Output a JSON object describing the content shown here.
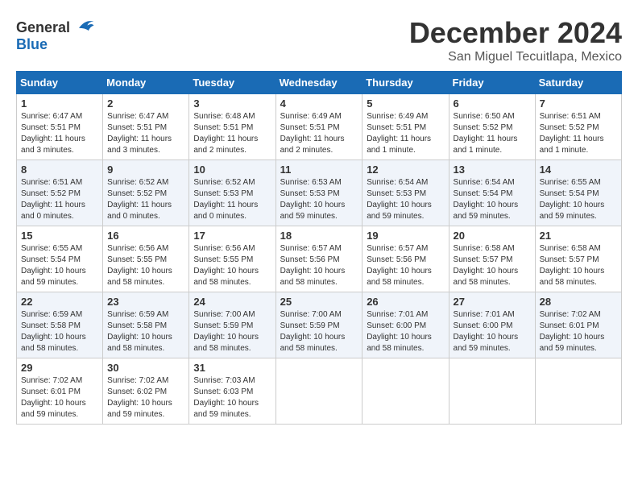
{
  "logo": {
    "general": "General",
    "blue": "Blue"
  },
  "header": {
    "month": "December 2024",
    "location": "San Miguel Tecuitlapa, Mexico"
  },
  "weekdays": [
    "Sunday",
    "Monday",
    "Tuesday",
    "Wednesday",
    "Thursday",
    "Friday",
    "Saturday"
  ],
  "weeks": [
    [
      {
        "day": "1",
        "sunrise": "6:47 AM",
        "sunset": "5:51 PM",
        "daylight": "11 hours and 3 minutes."
      },
      {
        "day": "2",
        "sunrise": "6:47 AM",
        "sunset": "5:51 PM",
        "daylight": "11 hours and 3 minutes."
      },
      {
        "day": "3",
        "sunrise": "6:48 AM",
        "sunset": "5:51 PM",
        "daylight": "11 hours and 2 minutes."
      },
      {
        "day": "4",
        "sunrise": "6:49 AM",
        "sunset": "5:51 PM",
        "daylight": "11 hours and 2 minutes."
      },
      {
        "day": "5",
        "sunrise": "6:49 AM",
        "sunset": "5:51 PM",
        "daylight": "11 hours and 1 minute."
      },
      {
        "day": "6",
        "sunrise": "6:50 AM",
        "sunset": "5:52 PM",
        "daylight": "11 hours and 1 minute."
      },
      {
        "day": "7",
        "sunrise": "6:51 AM",
        "sunset": "5:52 PM",
        "daylight": "11 hours and 1 minute."
      }
    ],
    [
      {
        "day": "8",
        "sunrise": "6:51 AM",
        "sunset": "5:52 PM",
        "daylight": "11 hours and 0 minutes."
      },
      {
        "day": "9",
        "sunrise": "6:52 AM",
        "sunset": "5:52 PM",
        "daylight": "11 hours and 0 minutes."
      },
      {
        "day": "10",
        "sunrise": "6:52 AM",
        "sunset": "5:53 PM",
        "daylight": "11 hours and 0 minutes."
      },
      {
        "day": "11",
        "sunrise": "6:53 AM",
        "sunset": "5:53 PM",
        "daylight": "10 hours and 59 minutes."
      },
      {
        "day": "12",
        "sunrise": "6:54 AM",
        "sunset": "5:53 PM",
        "daylight": "10 hours and 59 minutes."
      },
      {
        "day": "13",
        "sunrise": "6:54 AM",
        "sunset": "5:54 PM",
        "daylight": "10 hours and 59 minutes."
      },
      {
        "day": "14",
        "sunrise": "6:55 AM",
        "sunset": "5:54 PM",
        "daylight": "10 hours and 59 minutes."
      }
    ],
    [
      {
        "day": "15",
        "sunrise": "6:55 AM",
        "sunset": "5:54 PM",
        "daylight": "10 hours and 59 minutes."
      },
      {
        "day": "16",
        "sunrise": "6:56 AM",
        "sunset": "5:55 PM",
        "daylight": "10 hours and 58 minutes."
      },
      {
        "day": "17",
        "sunrise": "6:56 AM",
        "sunset": "5:55 PM",
        "daylight": "10 hours and 58 minutes."
      },
      {
        "day": "18",
        "sunrise": "6:57 AM",
        "sunset": "5:56 PM",
        "daylight": "10 hours and 58 minutes."
      },
      {
        "day": "19",
        "sunrise": "6:57 AM",
        "sunset": "5:56 PM",
        "daylight": "10 hours and 58 minutes."
      },
      {
        "day": "20",
        "sunrise": "6:58 AM",
        "sunset": "5:57 PM",
        "daylight": "10 hours and 58 minutes."
      },
      {
        "day": "21",
        "sunrise": "6:58 AM",
        "sunset": "5:57 PM",
        "daylight": "10 hours and 58 minutes."
      }
    ],
    [
      {
        "day": "22",
        "sunrise": "6:59 AM",
        "sunset": "5:58 PM",
        "daylight": "10 hours and 58 minutes."
      },
      {
        "day": "23",
        "sunrise": "6:59 AM",
        "sunset": "5:58 PM",
        "daylight": "10 hours and 58 minutes."
      },
      {
        "day": "24",
        "sunrise": "7:00 AM",
        "sunset": "5:59 PM",
        "daylight": "10 hours and 58 minutes."
      },
      {
        "day": "25",
        "sunrise": "7:00 AM",
        "sunset": "5:59 PM",
        "daylight": "10 hours and 58 minutes."
      },
      {
        "day": "26",
        "sunrise": "7:01 AM",
        "sunset": "6:00 PM",
        "daylight": "10 hours and 58 minutes."
      },
      {
        "day": "27",
        "sunrise": "7:01 AM",
        "sunset": "6:00 PM",
        "daylight": "10 hours and 59 minutes."
      },
      {
        "day": "28",
        "sunrise": "7:02 AM",
        "sunset": "6:01 PM",
        "daylight": "10 hours and 59 minutes."
      }
    ],
    [
      {
        "day": "29",
        "sunrise": "7:02 AM",
        "sunset": "6:01 PM",
        "daylight": "10 hours and 59 minutes."
      },
      {
        "day": "30",
        "sunrise": "7:02 AM",
        "sunset": "6:02 PM",
        "daylight": "10 hours and 59 minutes."
      },
      {
        "day": "31",
        "sunrise": "7:03 AM",
        "sunset": "6:03 PM",
        "daylight": "10 hours and 59 minutes."
      },
      null,
      null,
      null,
      null
    ]
  ],
  "labels": {
    "sunrise": "Sunrise:",
    "sunset": "Sunset:",
    "daylight": "Daylight:"
  }
}
